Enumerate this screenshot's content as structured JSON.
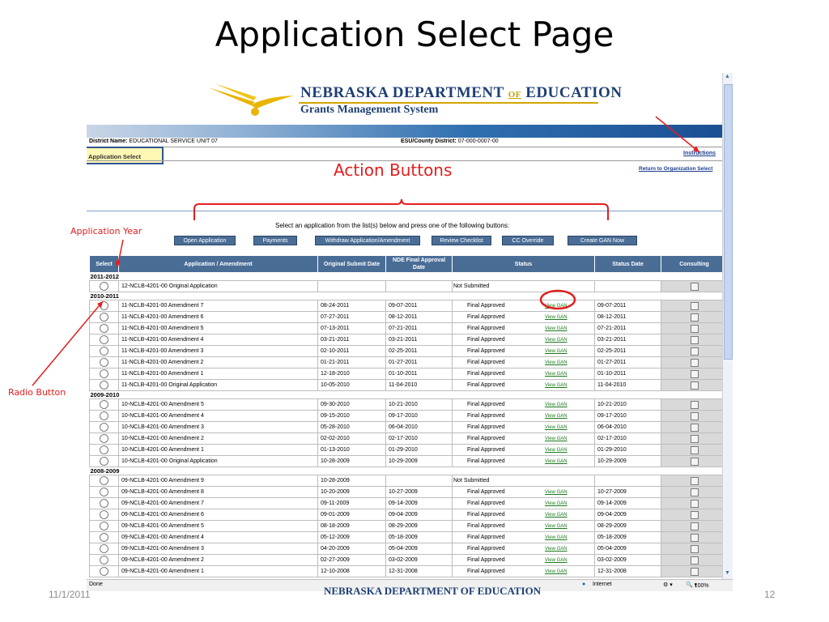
{
  "slide": {
    "title": "Application Select Page",
    "date": "11/1/2011",
    "page_number": "12",
    "footer_logo_text": "NEBRASKA DEPARTMENT OF EDUCATION"
  },
  "header": {
    "org_name_part1": "NEBRASKA DEPARTMENT ",
    "org_name_of": "OF",
    "org_name_part2": " EDUCATION",
    "system_name": "Grants Management System"
  },
  "district": {
    "district_label": "District Name:",
    "district_value": "EDUCATIONAL SERVICE UNIT 07",
    "esu_label": "ESU/County District:",
    "esu_value": "07-000-0007-00"
  },
  "nav": {
    "application_select": "Application Select",
    "instructions": "Instructions",
    "return_link": "Return to Organization Select"
  },
  "instructions_text": "Select an application from the list(s) below and press one of the following buttons:",
  "buttons": [
    "Open Application",
    "Payments",
    "Withdraw Application/Amendment",
    "Review Checklist",
    "CC Override",
    "Create GAN Now"
  ],
  "table": {
    "headers": {
      "select": "Select",
      "application": "Application / Amendment",
      "original": "Original Submit Date",
      "nde": "NDE Final Approval Date",
      "status": "Status",
      "status_date": "Status Date",
      "consulting": "Consulting"
    },
    "view_gan": "View GAN",
    "groups": [
      {
        "year": "2011-2012",
        "rows": [
          {
            "name": "12-NCLB-4201-00 Original Application",
            "orig": "",
            "nde": "",
            "status": "Not Submitted",
            "gan": false,
            "sdate": ""
          }
        ]
      },
      {
        "year": "2010-2011",
        "rows": [
          {
            "name": "11-NCLB-4201-00 Amendment 7",
            "orig": "08-24-2011",
            "nde": "09-07-2011",
            "status": "Final Approved",
            "gan": true,
            "sdate": "09-07-2011"
          },
          {
            "name": "11-NCLB-4201-00 Amendment 6",
            "orig": "07-27-2011",
            "nde": "08-12-2011",
            "status": "Final Approved",
            "gan": true,
            "sdate": "08-12-2011"
          },
          {
            "name": "11-NCLB-4201-00 Amendment 5",
            "orig": "07-13-2011",
            "nde": "07-21-2011",
            "status": "Final Approved",
            "gan": true,
            "sdate": "07-21-2011"
          },
          {
            "name": "11-NCLB-4201-00 Amendment 4",
            "orig": "03-21-2011",
            "nde": "03-21-2011",
            "status": "Final Approved",
            "gan": true,
            "sdate": "03-21-2011"
          },
          {
            "name": "11-NCLB-4201-00 Amendment 3",
            "orig": "02-10-2011",
            "nde": "02-25-2011",
            "status": "Final Approved",
            "gan": true,
            "sdate": "02-25-2011"
          },
          {
            "name": "11-NCLB-4201-00 Amendment 2",
            "orig": "01-21-2011",
            "nde": "01-27-2011",
            "status": "Final Approved",
            "gan": true,
            "sdate": "01-27-2011"
          },
          {
            "name": "11-NCLB-4201-00 Amendment 1",
            "orig": "12-18-2010",
            "nde": "01-10-2011",
            "status": "Final Approved",
            "gan": true,
            "sdate": "01-10-2011"
          },
          {
            "name": "11-NCLB-4201-00 Original Application",
            "orig": "10-05-2010",
            "nde": "11-04-2010",
            "status": "Final Approved",
            "gan": true,
            "sdate": "11-04-2010"
          }
        ]
      },
      {
        "year": "2009-2010",
        "rows": [
          {
            "name": "10-NCLB-4201-00 Amendment 5",
            "orig": "09-30-2010",
            "nde": "10-21-2010",
            "status": "Final Approved",
            "gan": true,
            "sdate": "10-21-2010"
          },
          {
            "name": "10-NCLB-4201-00 Amendment 4",
            "orig": "09-15-2010",
            "nde": "09-17-2010",
            "status": "Final Approved",
            "gan": true,
            "sdate": "09-17-2010"
          },
          {
            "name": "10-NCLB-4201-00 Amendment 3",
            "orig": "05-28-2010",
            "nde": "06-04-2010",
            "status": "Final Approved",
            "gan": true,
            "sdate": "06-04-2010"
          },
          {
            "name": "10-NCLB-4201-00 Amendment 2",
            "orig": "02-02-2010",
            "nde": "02-17-2010",
            "status": "Final Approved",
            "gan": true,
            "sdate": "02-17-2010"
          },
          {
            "name": "10-NCLB-4201-00 Amendment 1",
            "orig": "01-13-2010",
            "nde": "01-29-2010",
            "status": "Final Approved",
            "gan": true,
            "sdate": "01-29-2010"
          },
          {
            "name": "10-NCLB-4201-00 Original Application",
            "orig": "10-28-2009",
            "nde": "10-29-2009",
            "status": "Final Approved",
            "gan": true,
            "sdate": "10-29-2009"
          }
        ]
      },
      {
        "year": "2008-2009",
        "rows": [
          {
            "name": "09-NCLB-4201-00 Amendment 9",
            "orig": "10-28-2009",
            "nde": "",
            "status": "Not Submitted",
            "gan": false,
            "sdate": ""
          },
          {
            "name": "09-NCLB-4201-00 Amendment 8",
            "orig": "10-20-2009",
            "nde": "10-27-2009",
            "status": "Final Approved",
            "gan": true,
            "sdate": "10-27-2009"
          },
          {
            "name": "09-NCLB-4201-00 Amendment 7",
            "orig": "09-11-2009",
            "nde": "09-14-2009",
            "status": "Final Approved",
            "gan": true,
            "sdate": "09-14-2009"
          },
          {
            "name": "09-NCLB-4201-00 Amendment 6",
            "orig": "09-01-2009",
            "nde": "09-04-2009",
            "status": "Final Approved",
            "gan": true,
            "sdate": "09-04-2009"
          },
          {
            "name": "09-NCLB-4201-00 Amendment 5",
            "orig": "08-18-2009",
            "nde": "08-29-2009",
            "status": "Final Approved",
            "gan": true,
            "sdate": "08-29-2009"
          },
          {
            "name": "09-NCLB-4201-00 Amendment 4",
            "orig": "05-12-2009",
            "nde": "05-18-2009",
            "status": "Final Approved",
            "gan": true,
            "sdate": "05-18-2009"
          },
          {
            "name": "09-NCLB-4201-00 Amendment 3",
            "orig": "04-20-2009",
            "nde": "05-04-2009",
            "status": "Final Approved",
            "gan": true,
            "sdate": "05-04-2009"
          },
          {
            "name": "09-NCLB-4201-00 Amendment 2",
            "orig": "02-27-2009",
            "nde": "03-02-2009",
            "status": "Final Approved",
            "gan": true,
            "sdate": "03-02-2009"
          },
          {
            "name": "09-NCLB-4201-00 Amendment 1",
            "orig": "12-10-2008",
            "nde": "12-31-2008",
            "status": "Final Approved",
            "gan": true,
            "sdate": "12-31-2008"
          }
        ]
      }
    ]
  },
  "statusbar": {
    "left": "Done",
    "zone": "Internet",
    "zoom": "100%"
  },
  "annotations": {
    "action_buttons": "Action Buttons",
    "application_year": "Application Year",
    "radio_button": "Radio Button"
  },
  "colors": {
    "annotation": "#e31e1e",
    "header_blue": "#4a6d96",
    "org_navy": "#1e3f74",
    "link_green": "#1b7a1b"
  }
}
